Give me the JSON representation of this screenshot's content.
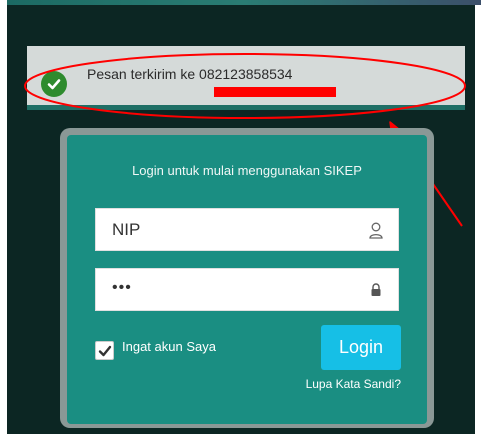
{
  "alert": {
    "message": "Pesan terkirim ke 082123858534",
    "icon": "check-circle-icon"
  },
  "login": {
    "title": "Login untuk mulai menggunakan SIKEP",
    "username_placeholder": "NIP",
    "password_value": "•••",
    "remember_label": "Ingat akun Saya",
    "remember_checked": true,
    "login_button": "Login",
    "forgot_link": "Lupa Kata Sandi?"
  },
  "colors": {
    "background": "#0c2623",
    "card": "#1a8e82",
    "button": "#16bfe6",
    "alert": "#d5dad9",
    "annotation": "#ff0000"
  }
}
